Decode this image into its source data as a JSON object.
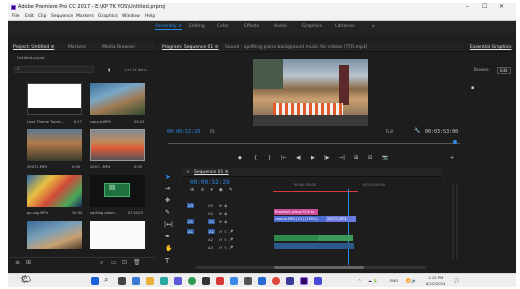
{
  "window": {
    "title": "Adobe Premiere Pro CC 2017 - E:\\KP TK YOS\\Untitled.prproj",
    "controls": [
      "–",
      "☐",
      "✕"
    ]
  },
  "menu": [
    "File",
    "Edit",
    "Clip",
    "Sequence",
    "Markers",
    "Graphics",
    "Window",
    "Help"
  ],
  "workspaces": {
    "items": [
      "Assembly",
      "Editing",
      "Color",
      "Effects",
      "Audio",
      "Graphics",
      "Libraries"
    ],
    "active_index": 0,
    "active_label": "Assembly ≡"
  },
  "project_panel": {
    "tabs": [
      "Project: Untitled ≡",
      "Markers",
      "Media Browser"
    ],
    "project_file": "Untitled.prproj",
    "item_count": "1 of 14 Item...",
    "items": [
      {
        "name": "Love Theme Tunes...",
        "duration": "0:17"
      },
      {
        "name": "capcut.MP4",
        "duration": "23:20"
      },
      {
        "name": "20071.MP4",
        "duration": "0:00"
      },
      {
        "name": "2007...MP4",
        "duration": "0:00"
      },
      {
        "name": "pp.cap.MP4",
        "duration": "30:30"
      },
      {
        "name": "sq:Blog plane...",
        "duration": "07:2023"
      },
      {
        "name": "",
        "duration": ""
      },
      {
        "name": "",
        "duration": ""
      }
    ]
  },
  "program_monitor": {
    "tab": "Program: Sequence 01 ≡",
    "tab_extra": "Sound - uplifting piano background music for videos (TTR.mp3)",
    "timecode_current": "00:00:52:29",
    "fit": "Fit",
    "quality": "Full",
    "timecode_duration": "00:03:53:00",
    "transport": [
      "◆",
      "{",
      "}",
      "|←",
      "◀|",
      "▶",
      "|▶",
      "→|",
      "⊞",
      "⊟",
      "📷"
    ]
  },
  "essential_graphics": {
    "title": "Essential Graphics",
    "tabs": [
      "Browse",
      "Edit"
    ]
  },
  "timeline": {
    "sequence_tab": "Sequence 01 ≡",
    "timecode": "00:00:52:29",
    "ruler": [
      "00:00:30:00",
      "00:01:00:00"
    ],
    "tracks": [
      "V3",
      "V2",
      "V1",
      "A1",
      "A2",
      "A3"
    ],
    "clips": {
      "v2": "Engmani group f3.6 sy",
      "v1": "capcut.MP4 [V1] [150%]",
      "v1b": "20071.MP4"
    }
  },
  "taskbar": {
    "language": "ENG",
    "time": "1:10 PM",
    "date": "8/10/2024"
  }
}
